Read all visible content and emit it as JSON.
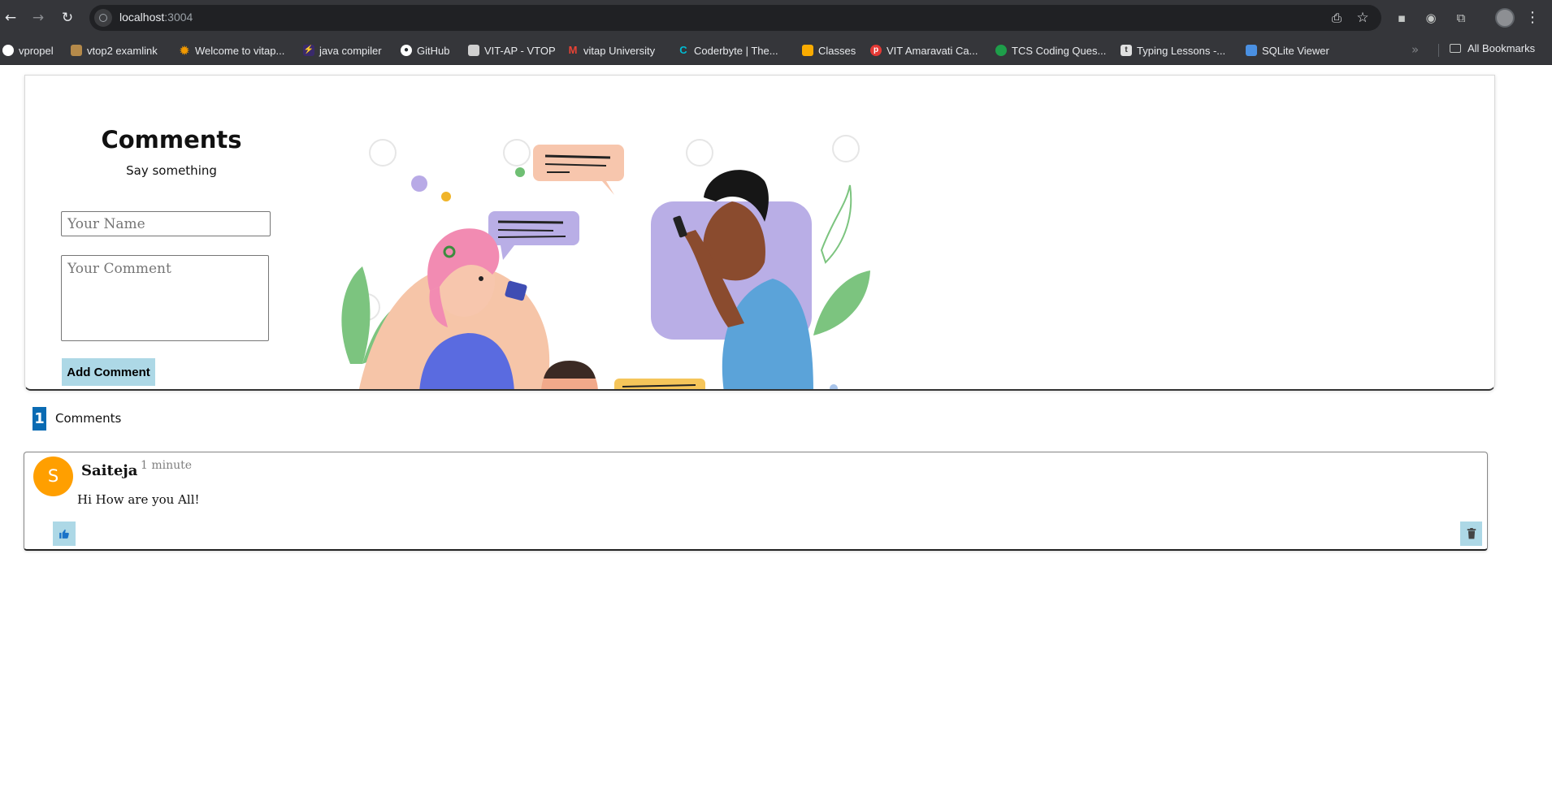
{
  "browser": {
    "url_host": "localhost",
    "url_port": ":3004",
    "bookmarks": [
      {
        "label": "vpropel",
        "icon": "circle-logo-icon",
        "color": "#ffffff"
      },
      {
        "label": "vtop2 examlink",
        "icon": "image-favicon-icon",
        "color": "#b58a4a"
      },
      {
        "label": "Welcome to vitap...",
        "icon": "sun-favicon-icon",
        "color": "#f29900"
      },
      {
        "label": "java compiler",
        "icon": "bolt-favicon-icon",
        "color": "#7c4dff"
      },
      {
        "label": "GitHub",
        "icon": "github-icon",
        "color": "#ffffff"
      },
      {
        "label": "VIT-AP - VTOP",
        "icon": "document-favicon-icon",
        "color": "#d0d0d0"
      },
      {
        "label": "vitap University",
        "icon": "gmail-icon",
        "color": "#ea4335"
      },
      {
        "label": "Coderbyte | The...",
        "icon": "coderbyte-icon",
        "color": "#00bcd4"
      },
      {
        "label": "Classes",
        "icon": "classroom-icon",
        "color": "#f9ab00"
      },
      {
        "label": "VIT Amaravati Ca...",
        "icon": "p-favicon-icon",
        "color": "#e53935"
      },
      {
        "label": "TCS Coding Ques...",
        "icon": "green-favicon-icon",
        "color": "#1e9e4a"
      },
      {
        "label": "Typing Lessons -...",
        "icon": "t-favicon-icon",
        "color": "#e0e0e0"
      },
      {
        "label": "SQLite Viewer",
        "icon": "sqlite-icon",
        "color": "#4a90e2"
      }
    ],
    "all_bookmarks": "All Bookmarks"
  },
  "form": {
    "title": "Comments",
    "subtitle": "Say something",
    "name_placeholder": "Your Name",
    "comment_placeholder": "Your Comment",
    "submit_label": "Add Comment"
  },
  "comments_count": {
    "count": "1",
    "label": "Comments"
  },
  "comments": [
    {
      "initial": "S",
      "author": "Saiteja",
      "time": "1 minute",
      "text": "Hi How are you All!",
      "avatar_color": "#ff9f00"
    }
  ],
  "colors": {
    "button_bg": "#add8e6",
    "badge_bg": "#0a6bb3",
    "avatar_bg": "#ff9f00"
  }
}
